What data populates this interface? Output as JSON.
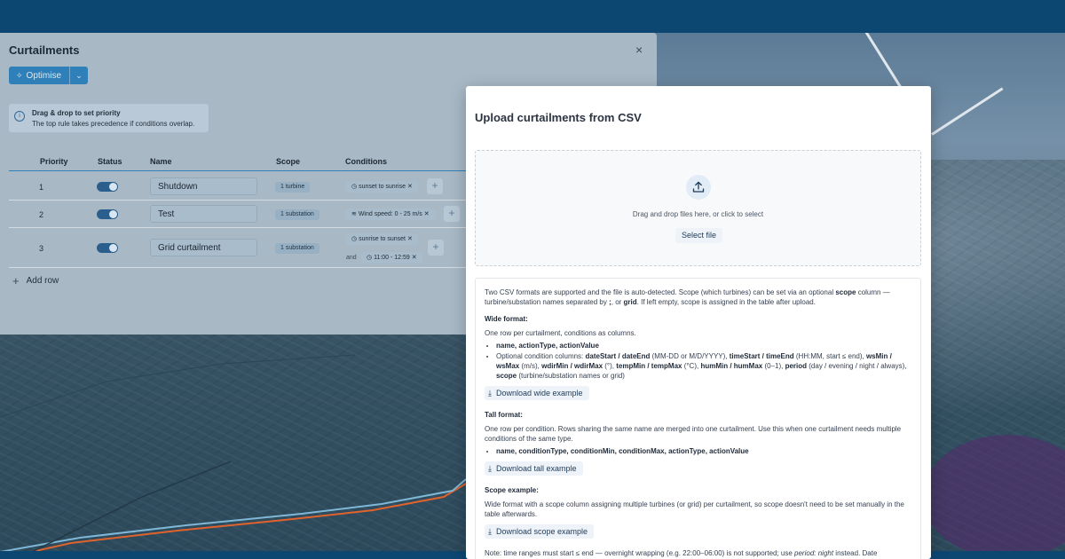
{
  "colors": {
    "accent": "#2f7fb8",
    "header": "#0c4772",
    "modal_bg": "#ffffff"
  },
  "panel": {
    "title": "Curtailments",
    "close_glyph": "×",
    "optimise_label": "Optimise",
    "hint_title": "Drag & drop to set priority",
    "hint_text": "The top rule takes precedence if conditions overlap.",
    "columns": [
      "Priority",
      "Status",
      "Name",
      "Scope",
      "Conditions"
    ],
    "rows": [
      {
        "priority": "1",
        "name": "Shutdown",
        "scope": "1 turbine",
        "conditions": [
          "sunset to sunrise"
        ]
      },
      {
        "priority": "2",
        "name": "Test",
        "scope": "1 substation",
        "conditions": [
          "Wind speed: 0 - 25 m/s"
        ]
      },
      {
        "priority": "3",
        "name": "Grid curtailment",
        "scope": "1 substation",
        "conditions": [
          "sunrise to sunset",
          "11:00 - 12:59"
        ],
        "and_label": "and"
      }
    ],
    "add_row_label": "Add row"
  },
  "modal": {
    "title": "Upload curtailments from CSV",
    "dropzone_text": "Drag and drop files here, or click to select",
    "select_file_label": "Select file",
    "intro_1": "Two CSV formats are supported and the file is auto-detected. Scope (which turbines) can be set via an optional ",
    "intro_b1": "scope",
    "intro_2": " column — turbine/substation names separated by ",
    "intro_b2": ";",
    "intro_3": ", or ",
    "intro_b3": "grid",
    "intro_4": ". If left empty, scope is assigned in the table after upload.",
    "wide_heading": "Wide format:",
    "wide_desc": "One row per curtailment, conditions as columns.",
    "wide_item_1": "name, actionType, actionValue",
    "wide_item_2_lead": "Optional condition columns: ",
    "wide_item_2_b1": "dateStart / dateEnd",
    "wide_item_2_t1": " (MM-DD or M/D/YYYY), ",
    "wide_item_2_b2": "timeStart / timeEnd",
    "wide_item_2_t2": " (HH:MM, start ≤ end), ",
    "wide_item_2_b3": "wsMin / wsMax",
    "wide_item_2_t3": " (m/s), ",
    "wide_item_2_b4": "wdirMin / wdirMax",
    "wide_item_2_t4": " (°), ",
    "wide_item_2_b5": "tempMin / tempMax",
    "wide_item_2_t5": " (°C), ",
    "wide_item_2_b6": "humMin / humMax",
    "wide_item_2_t6": " (0–1), ",
    "wide_item_2_b7": "period",
    "wide_item_2_t7": " (day / evening / night / always), ",
    "wide_item_2_b8": "scope",
    "wide_item_2_t8": " (turbine/substation names or grid)",
    "wide_download": "Download wide example",
    "tall_heading": "Tall format:",
    "tall_desc": "One row per condition. Rows sharing the same name are merged into one curtailment. Use this when one curtailment needs multiple conditions of the same type.",
    "tall_item_1": "name, conditionType, conditionMin, conditionMax, actionType, actionValue",
    "tall_download": "Download tall example",
    "scope_heading": "Scope example:",
    "scope_desc": "Wide format with a scope column assigning multiple turbines (or grid) per curtailment, so scope doesn't need to be set manually in the table afterwards.",
    "scope_download": "Download scope example",
    "note_1": "Note: time ranges must start ≤ end — overnight wrapping (e.g. 22:00–06:00) is not supported; use ",
    "note_i": "period: night",
    "note_2": " instead. Date"
  }
}
